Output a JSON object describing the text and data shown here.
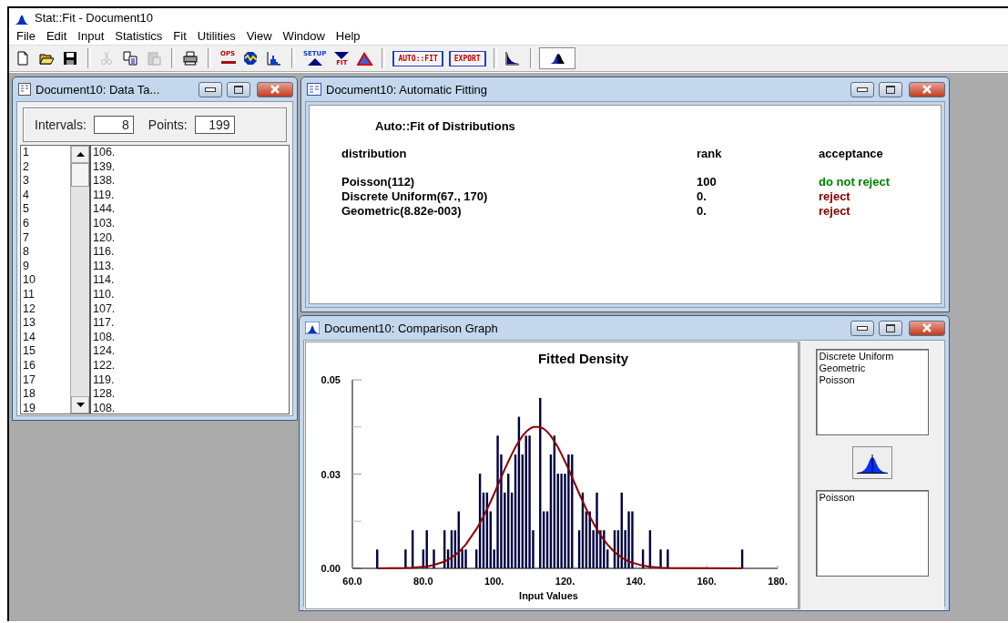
{
  "window": {
    "title": "Stat::Fit - Document10"
  },
  "menu": [
    "File",
    "Edit",
    "Input",
    "Statistics",
    "Fit",
    "Utilities",
    "View",
    "Window",
    "Help"
  ],
  "toolbar": [
    {
      "kind": "icon",
      "disabled": false,
      "pressed": false
    },
    {
      "kind": "icon",
      "disabled": false,
      "pressed": false
    },
    {
      "kind": "icon",
      "disabled": false,
      "pressed": false
    },
    {
      "kind": "separator"
    },
    {
      "kind": "icon",
      "disabled": true,
      "pressed": false
    },
    {
      "kind": "icon",
      "disabled": false,
      "pressed": false
    },
    {
      "kind": "icon",
      "disabled": true,
      "pressed": false
    },
    {
      "kind": "separator"
    },
    {
      "kind": "icon",
      "disabled": false,
      "pressed": false
    },
    {
      "kind": "separator"
    },
    {
      "kind": "icon-text",
      "label": "OPS",
      "disabled": false,
      "pressed": false
    },
    {
      "kind": "icon",
      "disabled": false,
      "pressed": false
    },
    {
      "kind": "icon",
      "disabled": false,
      "pressed": false
    },
    {
      "kind": "separator"
    },
    {
      "kind": "icon-text",
      "label": "SETUP",
      "disabled": false,
      "pressed": false
    },
    {
      "kind": "icon-text",
      "label": "FIT",
      "disabled": false,
      "pressed": false
    },
    {
      "kind": "icon",
      "disabled": false,
      "pressed": false
    },
    {
      "kind": "separator"
    },
    {
      "kind": "button",
      "label": "AUTO::FIT",
      "disabled": false,
      "pressed": false
    },
    {
      "kind": "button",
      "label": "EXPORT",
      "disabled": false,
      "pressed": false
    },
    {
      "kind": "separator"
    },
    {
      "kind": "icon",
      "disabled": false,
      "pressed": false
    },
    {
      "kind": "separator"
    },
    {
      "kind": "icon",
      "disabled": false,
      "pressed": true
    }
  ],
  "data_table": {
    "title": "Document10: Data Ta...",
    "intervals_label": "Intervals:",
    "intervals": "8",
    "points_label": "Points:",
    "points": "199",
    "rows": [
      {
        "index": "1",
        "value": "106."
      },
      {
        "index": "2",
        "value": "139."
      },
      {
        "index": "3",
        "value": "138."
      },
      {
        "index": "4",
        "value": "119."
      },
      {
        "index": "5",
        "value": "144."
      },
      {
        "index": "6",
        "value": "103."
      },
      {
        "index": "7",
        "value": "120."
      },
      {
        "index": "8",
        "value": "116."
      },
      {
        "index": "9",
        "value": "113."
      },
      {
        "index": "10",
        "value": "114."
      },
      {
        "index": "11",
        "value": "110."
      },
      {
        "index": "12",
        "value": "107."
      },
      {
        "index": "13",
        "value": "117."
      },
      {
        "index": "14",
        "value": "108."
      },
      {
        "index": "15",
        "value": "124."
      },
      {
        "index": "16",
        "value": "122."
      },
      {
        "index": "17",
        "value": "119."
      },
      {
        "index": "18",
        "value": "128."
      },
      {
        "index": "19",
        "value": "108."
      }
    ]
  },
  "auto_fit": {
    "title": "Document10: Automatic Fitting",
    "heading": "Auto::Fit of Distributions",
    "columns": [
      "distribution",
      "rank",
      "acceptance"
    ],
    "rows": [
      {
        "distribution": "Poisson(112)",
        "rank": "100",
        "acceptance": "do not reject",
        "color": "#008000"
      },
      {
        "distribution": "Discrete Uniform(67., 170)",
        "rank": "0.",
        "acceptance": "reject",
        "color": "#800000"
      },
      {
        "distribution": "Geometric(8.82e-003)",
        "rank": "0.",
        "acceptance": "reject",
        "color": "#800000"
      }
    ]
  },
  "comparison_graph": {
    "title": "Document10: Comparison Graph",
    "chart_data": {
      "type": "bar",
      "title": "Fitted Density",
      "xlabel": "Input Values",
      "x": [
        67,
        75,
        77,
        80,
        81,
        83,
        86,
        87,
        88,
        89,
        90,
        91,
        92,
        95,
        96,
        97,
        98,
        99,
        100,
        101,
        102,
        103,
        104,
        105,
        106,
        107,
        108,
        109,
        110,
        111,
        113,
        114,
        115,
        116,
        117,
        118,
        119,
        120,
        121,
        122,
        124,
        125,
        126,
        127,
        128,
        129,
        130,
        131,
        132,
        134,
        135,
        136,
        137,
        138,
        139,
        142,
        144,
        147,
        149,
        170
      ],
      "series": [
        {
          "color": "#000040",
          "values": [
            0.005,
            0.005,
            0.0101,
            0.005,
            0.0101,
            0.005,
            0.0101,
            0.005,
            0.0101,
            0.0101,
            0.0151,
            0.005,
            0.005,
            0.005,
            0.0251,
            0.0201,
            0.0201,
            0.0151,
            0.005,
            0.0352,
            0.0302,
            0.0201,
            0.0251,
            0.0201,
            0.0302,
            0.0402,
            0.0302,
            0.0352,
            0.0352,
            0.0101,
            0.0452,
            0.0151,
            0.0151,
            0.0302,
            0.0352,
            0.0251,
            0.0251,
            0.0251,
            0.0302,
            0.0302,
            0.0101,
            0.0201,
            0.0151,
            0.0151,
            0.0101,
            0.0201,
            0.0101,
            0.0101,
            0.005,
            0.0101,
            0.0101,
            0.0201,
            0.0101,
            0.0151,
            0.0151,
            0.005,
            0.0101,
            0.005,
            0.005,
            0.005
          ]
        },
        {
          "type": "line",
          "color": "#8b0000",
          "values": [
            0,
            0.0001,
            0.0002,
            0.0004,
            0.0005,
            0.0009,
            0.0018,
            0.0023,
            0.0029,
            0.0036,
            0.0043,
            0.0053,
            0.0063,
            0.0104,
            0.012,
            0.0138,
            0.0157,
            0.0177,
            0.0198,
            0.022,
            0.0241,
            0.0263,
            0.0283,
            0.0303,
            0.0321,
            0.0337,
            0.0351,
            0.0362,
            0.037,
            0.0375,
            0.0375,
            0.037,
            0.0362,
            0.0351,
            0.0337,
            0.0321,
            0.0303,
            0.0283,
            0.0263,
            0.0241,
            0.0198,
            0.0177,
            0.0157,
            0.0138,
            0.012,
            0.0104,
            0.0089,
            0.0075,
            0.0063,
            0.0043,
            0.0036,
            0.0029,
            0.0023,
            0.0018,
            0.0015,
            0.0007,
            0.0004,
            0.0002,
            0.0001,
            0
          ]
        }
      ],
      "xlim": [
        60,
        180
      ],
      "ylim": [
        0,
        0.05
      ],
      "xticks": [
        {
          "value": 60,
          "label": "60.0"
        },
        {
          "value": 80,
          "label": "80.0"
        },
        {
          "value": 100,
          "label": "100."
        },
        {
          "value": 120,
          "label": "120."
        },
        {
          "value": 140,
          "label": "140."
        },
        {
          "value": 160,
          "label": "160."
        },
        {
          "value": 180,
          "label": "180."
        }
      ],
      "yticks": [
        {
          "value": 0,
          "label": "0.00"
        },
        {
          "value": 0.025,
          "label": "0.03"
        },
        {
          "value": 0.05,
          "label": "0.05"
        }
      ]
    },
    "distributions": [
      "Discrete Uniform",
      "Geometric",
      "Poisson"
    ],
    "shown": [
      "Poisson"
    ]
  }
}
